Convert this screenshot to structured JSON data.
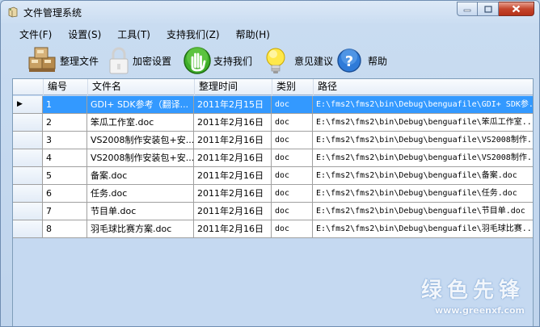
{
  "window": {
    "title": "文件管理系统"
  },
  "menu": [
    "文件(F)",
    "设置(S)",
    "工具(T)",
    "支持我们(Z)",
    "帮助(H)"
  ],
  "toolbar": {
    "organize_label": "整理文件",
    "encrypt_label": "加密设置",
    "support_label": "支持我们",
    "feedback_label": "意见建议",
    "help_label": "帮助",
    "help_symbol": "?"
  },
  "grid": {
    "columns": [
      "编号",
      "文件名",
      "整理时间",
      "类别",
      "路径"
    ],
    "rows": [
      {
        "id": "1",
        "name": "GDI+ SDK参考（翻译...",
        "date": "2011年2月15日",
        "type": "doc",
        "path": "E:\\fms2\\fms2\\bin\\Debug\\benguafile\\GDI+ SDK参..."
      },
      {
        "id": "2",
        "name": "笨瓜工作室.doc",
        "date": "2011年2月16日",
        "type": "doc",
        "path": "E:\\fms2\\fms2\\bin\\Debug\\benguafile\\笨瓜工作室..."
      },
      {
        "id": "3",
        "name": "VS2008制作安装包+安...",
        "date": "2011年2月16日",
        "type": "doc",
        "path": "E:\\fms2\\fms2\\bin\\Debug\\benguafile\\VS2008制作..."
      },
      {
        "id": "4",
        "name": "VS2008制作安装包+安...",
        "date": "2011年2月16日",
        "type": "doc",
        "path": "E:\\fms2\\fms2\\bin\\Debug\\benguafile\\VS2008制作..."
      },
      {
        "id": "5",
        "name": "备案.doc",
        "date": "2011年2月16日",
        "type": "doc",
        "path": "E:\\fms2\\fms2\\bin\\Debug\\benguafile\\备案.doc"
      },
      {
        "id": "6",
        "name": "任务.doc",
        "date": "2011年2月16日",
        "type": "doc",
        "path": "E:\\fms2\\fms2\\bin\\Debug\\benguafile\\任务.doc"
      },
      {
        "id": "7",
        "name": "节目单.doc",
        "date": "2011年2月16日",
        "type": "doc",
        "path": "E:\\fms2\\fms2\\bin\\Debug\\benguafile\\节目单.doc"
      },
      {
        "id": "8",
        "name": "羽毛球比赛方案.doc",
        "date": "2011年2月16日",
        "type": "doc",
        "path": "E:\\fms2\\fms2\\bin\\Debug\\benguafile\\羽毛球比赛..."
      }
    ],
    "selected_row": 0,
    "row_pointer": "▶"
  },
  "watermark": {
    "text": "绿色先锋",
    "url": "www.greenxf.com"
  },
  "colors": {
    "selection": "#3399ff",
    "window_bg": "#c9dcf1"
  }
}
